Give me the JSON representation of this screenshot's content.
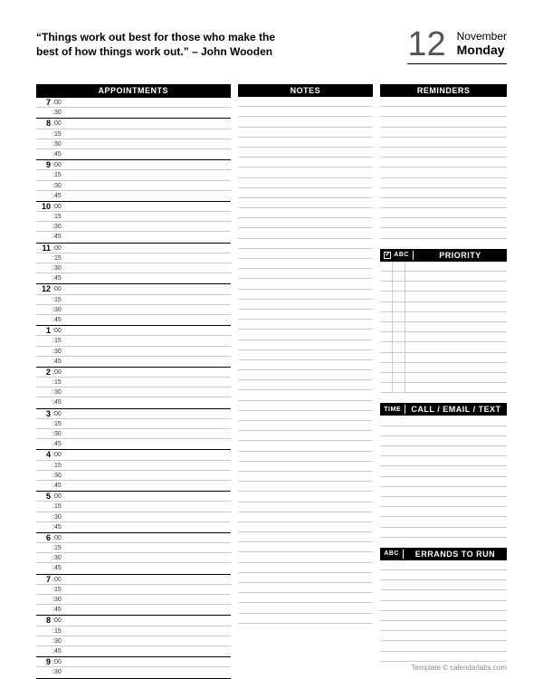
{
  "header": {
    "quote": "“Things work out best for those who make the best of how things work out.” – John Wooden",
    "day_number": "12",
    "month": "November",
    "weekday": "Monday"
  },
  "sections": {
    "appointments": "APPOINTMENTS",
    "notes": "NOTES",
    "reminders": "REMINDERS",
    "priority_sub": "ABC",
    "priority": "PRIORITY",
    "call_sub": "TIME",
    "call": "CALL / EMAIL / TEXT",
    "errands_sub": "ABC",
    "errands": "ERRANDS TO RUN"
  },
  "appointments": {
    "hours": [
      "7",
      "8",
      "9",
      "10",
      "11",
      "12",
      "1",
      "2",
      "3",
      "4",
      "5",
      "6",
      "7",
      "8",
      "9"
    ],
    "slots_first": [
      ":00",
      ":30"
    ],
    "slots_full": [
      ":00",
      ":15",
      ":30",
      ":45"
    ],
    "slots_last": [
      ":00",
      ":30"
    ]
  },
  "counts": {
    "notes_lines": 52,
    "reminders_lines": 14,
    "priority_lines": 13,
    "call_lines": 12,
    "errands_lines": 10
  },
  "footer": "Template © calendarlabs.com"
}
